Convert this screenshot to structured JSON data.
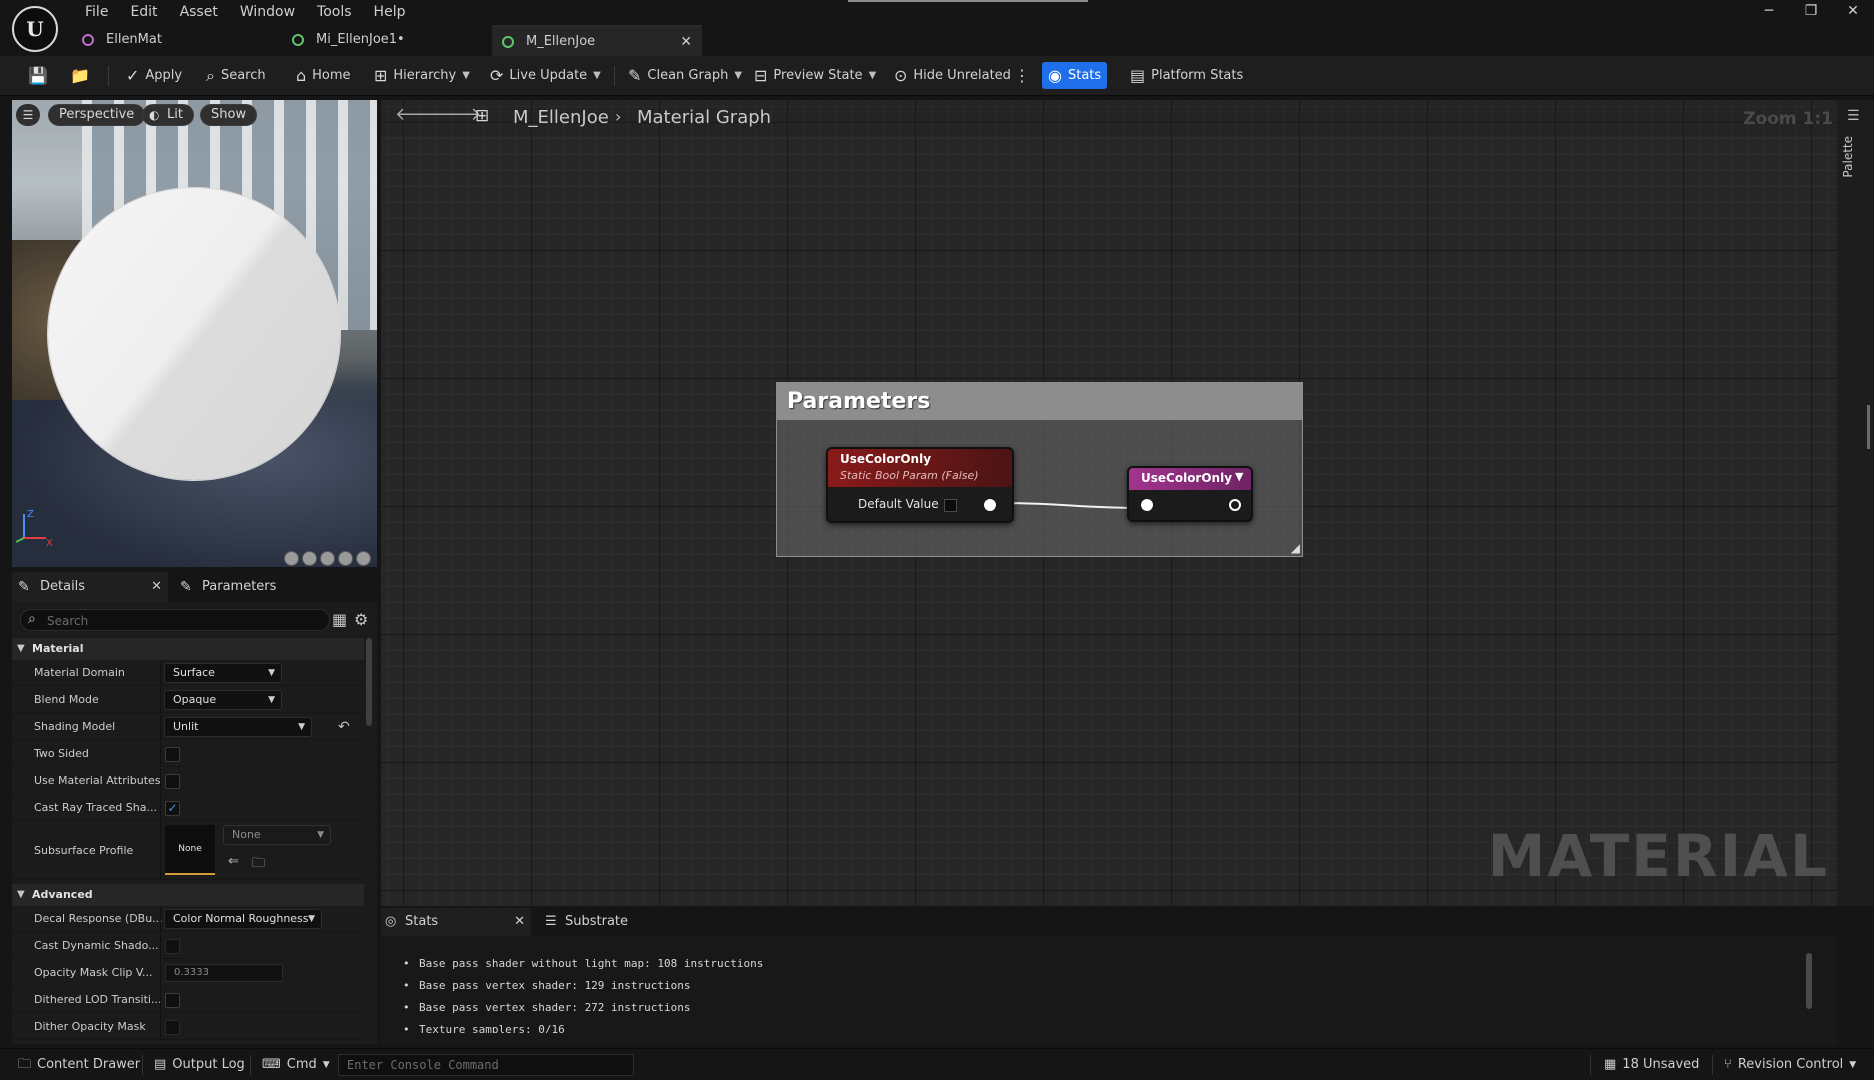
{
  "app": {
    "menu": [
      "File",
      "Edit",
      "Asset",
      "Window",
      "Tools",
      "Help"
    ],
    "tabs": [
      {
        "label": "EllenMat",
        "active": false,
        "color": "#c26bd0"
      },
      {
        "label": "Mi_EllenJoe1•",
        "active": false,
        "color": "#61c36b"
      },
      {
        "label": "M_EllenJoe",
        "active": true,
        "color": "#61c36b"
      }
    ],
    "window_controls": [
      "─",
      "❐",
      "✕"
    ]
  },
  "toolbar": {
    "apply": "Apply",
    "search": "Search",
    "home": "Home",
    "hierarchy": "Hierarchy",
    "live_update": "Live Update",
    "clean_graph": "Clean Graph",
    "preview_state": "Preview State",
    "hide_unrelated": "Hide Unrelated",
    "stats": "Stats",
    "platform_stats": "Platform Stats",
    "stats_active_color": "#1f6feb"
  },
  "viewport": {
    "perspective": "Perspective",
    "lit": "Lit",
    "show": "Show",
    "axis_z": "Z",
    "axis_x": "X"
  },
  "details": {
    "tab_details": "Details",
    "tab_parameters": "Parameters",
    "search_placeholder": "Search",
    "section_material": "Material",
    "section_advanced": "Advanced",
    "rows": {
      "material_domain": {
        "label": "Material Domain",
        "value": "Surface"
      },
      "blend_mode": {
        "label": "Blend Mode",
        "value": "Opaque"
      },
      "shading_model": {
        "label": "Shading Model",
        "value": "Unlit"
      },
      "two_sided": {
        "label": "Two Sided",
        "checked": false
      },
      "use_material_attributes": {
        "label": "Use Material Attributes",
        "checked": false
      },
      "cast_ray_traced": {
        "label": "Cast Ray Traced Sha...",
        "checked": true
      },
      "subsurface_profile": {
        "label": "Subsurface Profile",
        "thumb": "None",
        "value": "None"
      },
      "decal_response": {
        "label": "Decal Response (DBu...",
        "value": "Color Normal Roughness"
      },
      "cast_dynamic_shadow": {
        "label": "Cast Dynamic Shado...",
        "checked": false
      },
      "opacity_mask_clip": {
        "label": "Opacity Mask Clip V...",
        "value": "0.3333"
      },
      "dithered_lod": {
        "label": "Dithered LOD Transiti...",
        "checked": false
      },
      "dither_opacity_mask": {
        "label": "Dither Opacity Mask",
        "checked": false
      }
    }
  },
  "graph": {
    "breadcrumb_asset": "M_EllenJoe",
    "breadcrumb_graph": "Material Graph",
    "zoom": "Zoom 1:1",
    "watermark": "MATERIAL",
    "palette": "Palette",
    "comment_title": "Parameters",
    "node_param": {
      "title": "UseColorOnly",
      "subtitle": "Static Bool Param (False)",
      "pin_label": "Default Value",
      "header_color": "#8a1a1a"
    },
    "node_switch": {
      "title": "UseColorOnly",
      "header_color": "#a2348e"
    }
  },
  "stats": {
    "tab_stats": "Stats",
    "tab_substrate": "Substrate",
    "lines": [
      "Base pass shader without light map: 108 instructions",
      "Base pass vertex shader: 129 instructions",
      "Base pass vertex shader: 272 instructions",
      "Texture samplers: 0/16"
    ]
  },
  "bottom": {
    "content_drawer": "Content Drawer",
    "output_log": "Output Log",
    "cmd": "Cmd",
    "console_placeholder": "Enter Console Command",
    "unsaved": "18 Unsaved",
    "revision_control": "Revision Control"
  }
}
